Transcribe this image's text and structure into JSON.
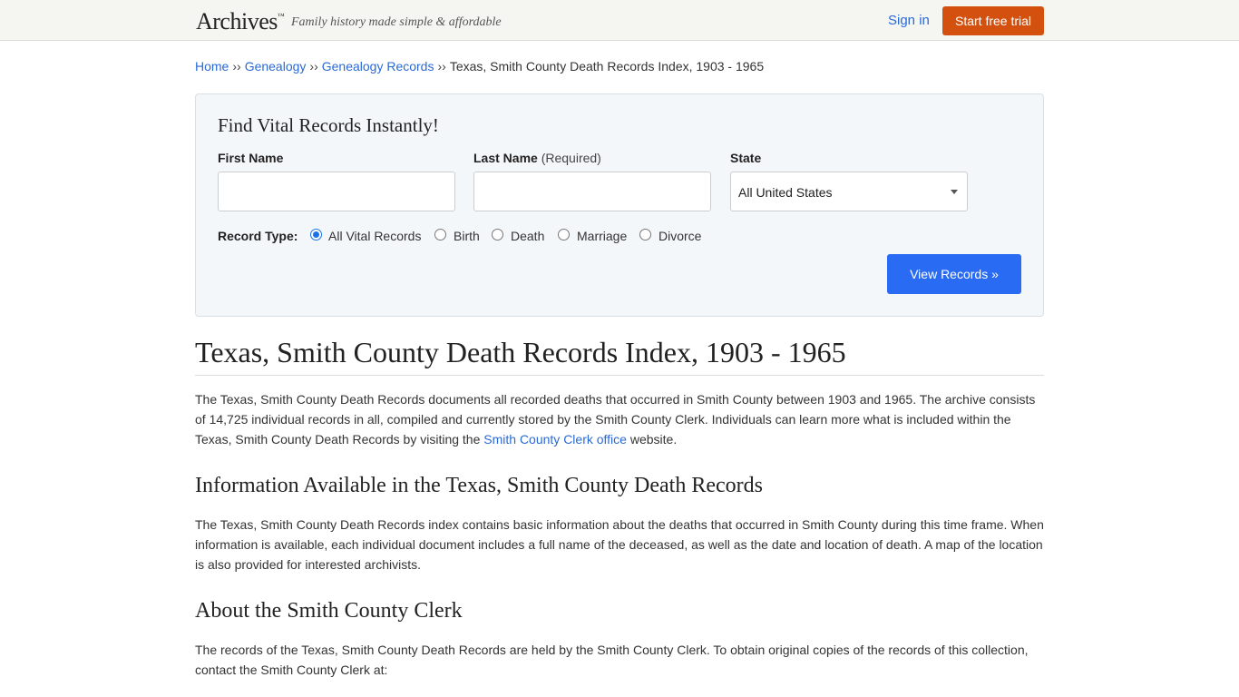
{
  "header": {
    "logo": "Archives",
    "logo_tm": "™",
    "tagline": "Family history made simple & affordable",
    "sign_in": "Sign in",
    "trial_button": "Start free trial"
  },
  "breadcrumb": {
    "items": [
      "Home",
      "Genealogy",
      "Genealogy Records"
    ],
    "separator": "››",
    "current": "Texas, Smith County Death Records Index, 1903 - 1965"
  },
  "search": {
    "title": "Find Vital Records Instantly!",
    "first_name_label": "First Name",
    "last_name_label": "Last Name",
    "last_name_required": "(Required)",
    "state_label": "State",
    "state_value": "All United States",
    "record_type_label": "Record Type:",
    "record_types": [
      "All Vital Records",
      "Birth",
      "Death",
      "Marriage",
      "Divorce"
    ],
    "selected_record_type": "All Vital Records",
    "submit": "View Records »"
  },
  "content": {
    "title": "Texas, Smith County Death Records Index, 1903 - 1965",
    "intro_part1": "The Texas, Smith County Death Records documents all recorded deaths that occurred in Smith County between 1903 and 1965. The archive consists of 14,725 individual records in all, compiled and currently stored by the Smith County Clerk. Individuals can learn more what is included within the Texas, Smith County Death Records by visiting the ",
    "intro_link": "Smith County Clerk office",
    "intro_part2": " website.",
    "section1_heading": "Information Available in the Texas, Smith County Death Records",
    "section1_text": "The Texas, Smith County Death Records index contains basic information about the deaths that occurred in Smith County during this time frame. When information is available, each individual document includes a full name of the deceased, as well as the date and location of death. A map of the location is also provided for interested archivists.",
    "section2_heading": "About the Smith County Clerk",
    "section2_text": "The records of the Texas, Smith County Death Records are held by the Smith County Clerk. To obtain original copies of the records of this collection, contact the Smith County Clerk at:"
  },
  "colors": {
    "accent_orange": "#d4500f",
    "accent_blue": "#2a6bf3",
    "link": "#2a6ad6"
  }
}
